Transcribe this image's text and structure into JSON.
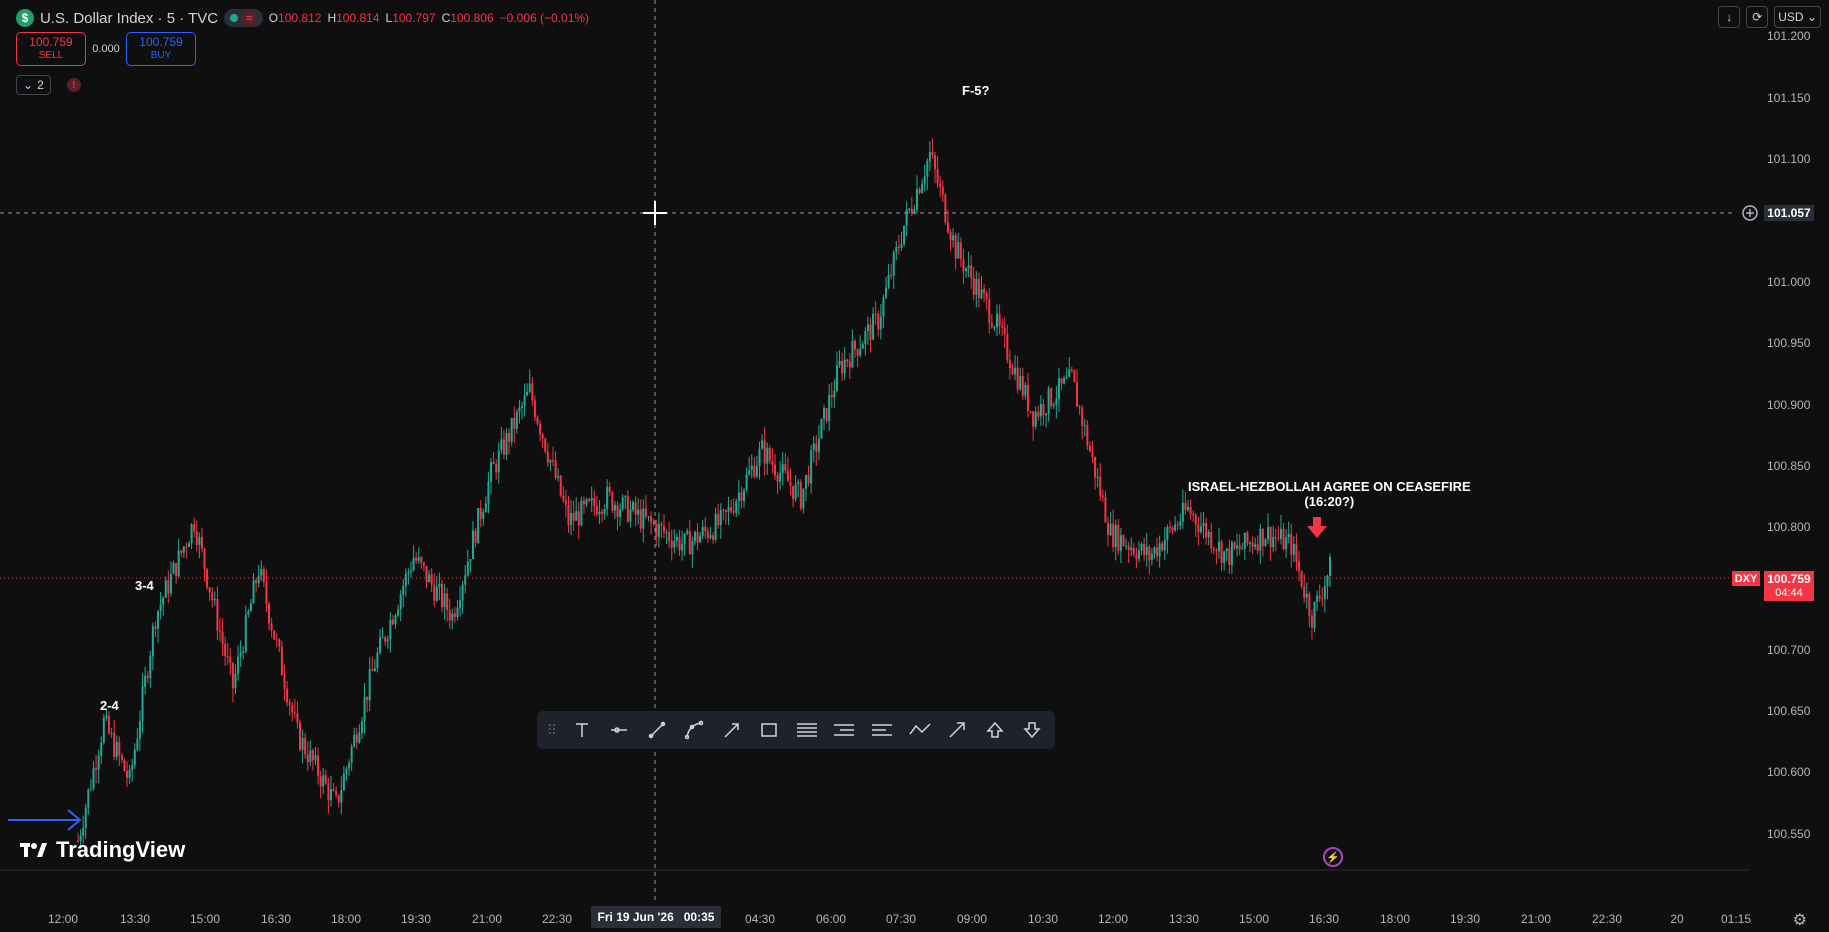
{
  "header": {
    "symbol_icon": "dollar-icon",
    "title": "U.S. Dollar Index · 5 · TVC",
    "open_label": "O",
    "open": "100.812",
    "high_label": "H",
    "high": "100.814",
    "low_label": "L",
    "low": "100.797",
    "close_label": "C",
    "close": "100.806",
    "change": "−0.006 (−0.01%)"
  },
  "trade": {
    "sell_price": "100.759",
    "sell_label": "SELL",
    "spread": "0.000",
    "buy_price": "100.759",
    "buy_label": "BUY"
  },
  "indicators": {
    "count": "2",
    "alert_icon": "!"
  },
  "top_right": {
    "currency": "USD"
  },
  "price_axis": {
    "labels": [
      "101.200",
      "101.150",
      "101.100",
      "101.000",
      "100.950",
      "100.900",
      "100.850",
      "100.800",
      "100.700",
      "100.650",
      "100.600",
      "100.550"
    ],
    "crosshair_price": "101.057",
    "last_symbol": "DXY",
    "last_price": "100.759",
    "countdown": "04:44"
  },
  "time_axis": {
    "labels": [
      "12:00",
      "13:30",
      "15:00",
      "16:30",
      "18:00",
      "19:30",
      "21:00",
      "22:30",
      "04:30",
      "06:00",
      "07:30",
      "09:00",
      "10:30",
      "12:00",
      "13:30",
      "15:00",
      "16:30",
      "18:00",
      "19:30",
      "21:00",
      "22:30",
      "20",
      "01:15"
    ],
    "crosshair_time": "Fri 19 Jun '26   00:35"
  },
  "annotations": {
    "peak": "F-5?",
    "level_34": "3-4",
    "level_24": "2-4",
    "news_line1": "ISRAEL-HEZBOLLAH AGREE ON CEASEFIRE",
    "news_line2": "(16:20?)"
  },
  "branding": {
    "logo_text": "TradingView"
  },
  "colors": {
    "up": "#22ab94",
    "down": "#f23645",
    "background": "#0f0f0f",
    "arrow": "#2962ff"
  },
  "toolbar_icons": [
    "text-icon",
    "horizontal-ray-icon",
    "trend-line-icon",
    "path-icon",
    "arrow-marker-icon",
    "rectangle-icon",
    "fib-retracement-icon",
    "long-position-icon",
    "short-position-icon",
    "polyline-icon",
    "arrow-icon",
    "arrow-up-icon",
    "arrow-down-icon"
  ],
  "chart_data": {
    "type": "candlestick",
    "title": "",
    "xlabel": "",
    "ylabel": "",
    "ylim": [
      100.515,
      101.215
    ],
    "x_range": [
      "12:00",
      "01:15"
    ],
    "grid": false,
    "last_price": 100.759,
    "crosshair": {
      "price": 101.057,
      "time": "Fri 19 Jun '26 00:35"
    },
    "anchors": [
      {
        "t": 0,
        "p": 100.53
      },
      {
        "t": 10,
        "p": 100.63
      },
      {
        "t": 20,
        "p": 100.58
      },
      {
        "t": 30,
        "p": 100.72
      },
      {
        "t": 45,
        "p": 100.8
      },
      {
        "t": 60,
        "p": 100.66
      },
      {
        "t": 70,
        "p": 100.76
      },
      {
        "t": 85,
        "p": 100.62
      },
      {
        "t": 100,
        "p": 100.56
      },
      {
        "t": 115,
        "p": 100.68
      },
      {
        "t": 130,
        "p": 100.77
      },
      {
        "t": 145,
        "p": 100.72
      },
      {
        "t": 160,
        "p": 100.84
      },
      {
        "t": 175,
        "p": 100.91
      },
      {
        "t": 190,
        "p": 100.8
      },
      {
        "t": 205,
        "p": 100.82
      },
      {
        "t": 220,
        "p": 100.8
      },
      {
        "t": 235,
        "p": 100.78
      },
      {
        "t": 250,
        "p": 100.8
      },
      {
        "t": 265,
        "p": 100.86
      },
      {
        "t": 280,
        "p": 100.82
      },
      {
        "t": 295,
        "p": 100.93
      },
      {
        "t": 310,
        "p": 100.97
      },
      {
        "t": 320,
        "p": 101.05
      },
      {
        "t": 330,
        "p": 101.11
      },
      {
        "t": 340,
        "p": 101.03
      },
      {
        "t": 355,
        "p": 100.97
      },
      {
        "t": 370,
        "p": 100.89
      },
      {
        "t": 385,
        "p": 100.92
      },
      {
        "t": 400,
        "p": 100.79
      },
      {
        "t": 415,
        "p": 100.77
      },
      {
        "t": 430,
        "p": 100.81
      },
      {
        "t": 445,
        "p": 100.77
      },
      {
        "t": 460,
        "p": 100.79
      },
      {
        "t": 470,
        "p": 100.78
      },
      {
        "t": 478,
        "p": 100.72
      },
      {
        "t": 485,
        "p": 100.76
      }
    ],
    "x_time_span": 485
  }
}
